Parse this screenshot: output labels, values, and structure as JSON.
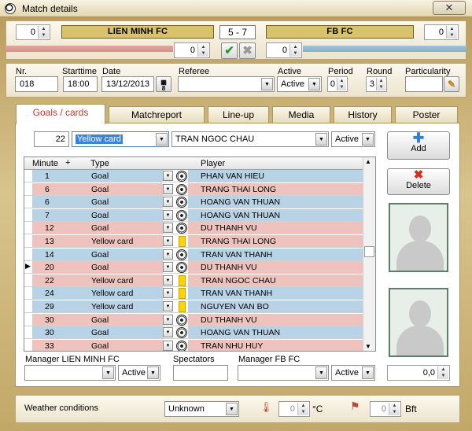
{
  "window": {
    "title": "Match details",
    "close_glyph": "✕",
    "app_icon": "soccer-ball-icon"
  },
  "header": {
    "home_team": "LIEN MINH FC",
    "away_team": "FB FC",
    "score": "5  - 7",
    "home_spin": "0",
    "away_spin": "0",
    "home_secondary": "0",
    "away_secondary": "0",
    "home_color": "#d8948f",
    "away_color": "#8fb5d5",
    "confirm_icon": "checkmark-icon",
    "cancel_icon": "cross-icon"
  },
  "info": {
    "nr_label": "Nr.",
    "nr_value": "018",
    "starttime_label": "Starttime",
    "starttime_value": "18:00",
    "date_label": "Date",
    "date_value": "13/12/2013",
    "referee_label": "Referee",
    "referee_value": "",
    "active_label": "Active",
    "active_value": "Active",
    "period_label": "Period",
    "period_value": "0",
    "round_label": "Round",
    "round_value": "3",
    "particularity_label": "Particularity",
    "particularity_value": ""
  },
  "tabs": [
    "Goals / cards",
    "Matchreport",
    "Line-up",
    "Media",
    "History",
    "Poster"
  ],
  "event_input": {
    "minute": "22",
    "type": "Yellow card",
    "player": "TRAN NGOC CHAU",
    "status": "Active"
  },
  "grid": {
    "headers": {
      "minute": "Minute",
      "plus": "+",
      "type": "Type",
      "player": "Player"
    },
    "rows": [
      {
        "minute": "1",
        "type": "Goal",
        "player": "PHAN VAN HIEU",
        "team": "blue",
        "icon": "ball"
      },
      {
        "minute": "6",
        "type": "Goal",
        "player": "TRANG THAI LONG",
        "team": "red",
        "icon": "ball"
      },
      {
        "minute": "6",
        "type": "Goal",
        "player": "HOANG VAN THUAN",
        "team": "blue",
        "icon": "ball"
      },
      {
        "minute": "7",
        "type": "Goal",
        "player": "HOANG VAN THUAN",
        "team": "blue",
        "icon": "ball"
      },
      {
        "minute": "12",
        "type": "Goal",
        "player": "DU THANH VU",
        "team": "red",
        "icon": "ball"
      },
      {
        "minute": "13",
        "type": "Yellow card",
        "player": "TRANG THAI LONG",
        "team": "red",
        "icon": "card"
      },
      {
        "minute": "14",
        "type": "Goal",
        "player": "TRAN VAN THANH",
        "team": "blue",
        "icon": "ball"
      },
      {
        "minute": "20",
        "type": "Goal",
        "player": "DU THANH VU",
        "team": "red",
        "icon": "ball",
        "current": true
      },
      {
        "minute": "22",
        "type": "Yellow card",
        "player": "TRAN NGOC CHAU",
        "team": "red",
        "icon": "card"
      },
      {
        "minute": "24",
        "type": "Yellow card",
        "player": "TRAN VAN THANH",
        "team": "blue",
        "icon": "card"
      },
      {
        "minute": "29",
        "type": "Yellow card",
        "player": "NGUYEN VAN BO",
        "team": "blue",
        "icon": "card"
      },
      {
        "minute": "30",
        "type": "Goal",
        "player": "DU THANH VU",
        "team": "red",
        "icon": "ball"
      },
      {
        "minute": "30",
        "type": "Goal",
        "player": "HOANG VAN THUAN",
        "team": "blue",
        "icon": "ball"
      },
      {
        "minute": "33",
        "type": "Goal",
        "player": "TRAN NHU HUY",
        "team": "red",
        "icon": "ball"
      }
    ]
  },
  "side": {
    "add_label": "Add",
    "delete_label": "Delete",
    "value": "0,0"
  },
  "managers": {
    "home_label": "Manager LIEN MINH FC",
    "home_status": "Active",
    "spectators_label": "Spectators",
    "spectators_value": "",
    "away_label": "Manager FB FC",
    "away_status": "Active"
  },
  "weather": {
    "label": "Weather conditions",
    "condition": "Unknown",
    "temp": "0",
    "temp_unit": "°C",
    "wind": "0",
    "wind_unit": "Bft",
    "thermometer_icon": "thermometer-icon",
    "wind_icon": "windsock-icon"
  },
  "colors": {
    "blue_row": "#b8d2e6",
    "red_row": "#efc3bd",
    "accent": "#c0392b"
  }
}
